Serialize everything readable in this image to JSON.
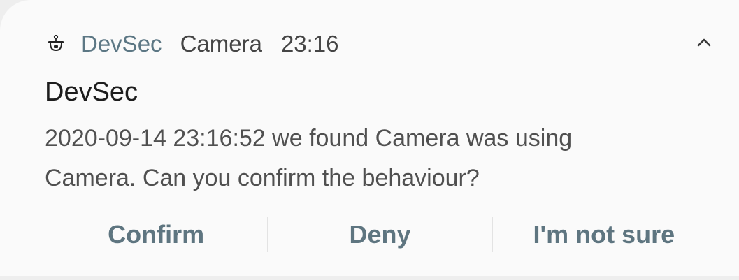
{
  "notification": {
    "app_icon": "cctv-camera-icon",
    "app_name": "DevSec",
    "sub_text": "Camera",
    "time": "23:16",
    "expand_icon": "chevron-up-icon",
    "title": "DevSec",
    "body_line1": "2020-09-14 23:16:52 we found Camera was using",
    "body_line2": "Camera. Can you confirm the behaviour?",
    "actions": [
      {
        "label": "Confirm"
      },
      {
        "label": "Deny"
      },
      {
        "label": "I'm not sure"
      }
    ]
  },
  "colors": {
    "app_name": "#5c7784",
    "action": "#5e7580",
    "background": "#fafafa"
  }
}
